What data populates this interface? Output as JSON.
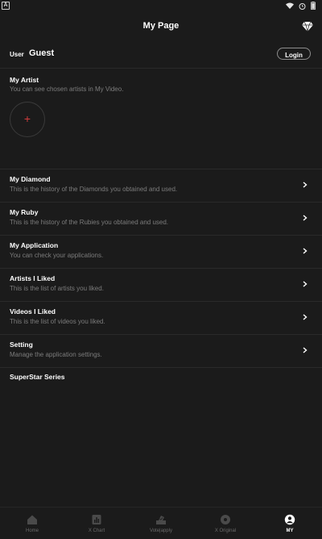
{
  "status": {
    "app_badge": "A",
    "icons": [
      "wifi-icon",
      "alarm-icon",
      "battery-icon"
    ]
  },
  "header": {
    "title": "My Page",
    "icon": "diamond-icon"
  },
  "user": {
    "label": "User",
    "name": "Guest",
    "login_label": "Login"
  },
  "my_artist": {
    "title": "My Artist",
    "subtitle": "You can see chosen artists in My Video.",
    "add_symbol": "+"
  },
  "menu": [
    {
      "title": "My Diamond",
      "subtitle": "This is the history of the Diamonds you obtained and used."
    },
    {
      "title": "My Ruby",
      "subtitle": "This is the history of the Rubies you obtained and used."
    },
    {
      "title": "My Application",
      "subtitle": "You can check your applications."
    },
    {
      "title": "Artists I Liked",
      "subtitle": "This is the list of artists you liked."
    },
    {
      "title": "Videos I Liked",
      "subtitle": "This is the list of videos you liked."
    },
    {
      "title": "Setting",
      "subtitle": "Manage the application settings."
    }
  ],
  "series_label": "SuperStar Series",
  "tabs": [
    {
      "label": "Home",
      "icon": "home-icon"
    },
    {
      "label": "X Chart",
      "icon": "chart-icon"
    },
    {
      "label": "Vote|apply",
      "icon": "vote-icon"
    },
    {
      "label": "X Original",
      "icon": "original-icon"
    },
    {
      "label": "MY",
      "icon": "profile-icon",
      "active": true
    }
  ],
  "colors": {
    "background": "#1b1b1b",
    "text": "#ffffff",
    "muted": "#7c7c7c",
    "accent": "#d23c3c"
  }
}
